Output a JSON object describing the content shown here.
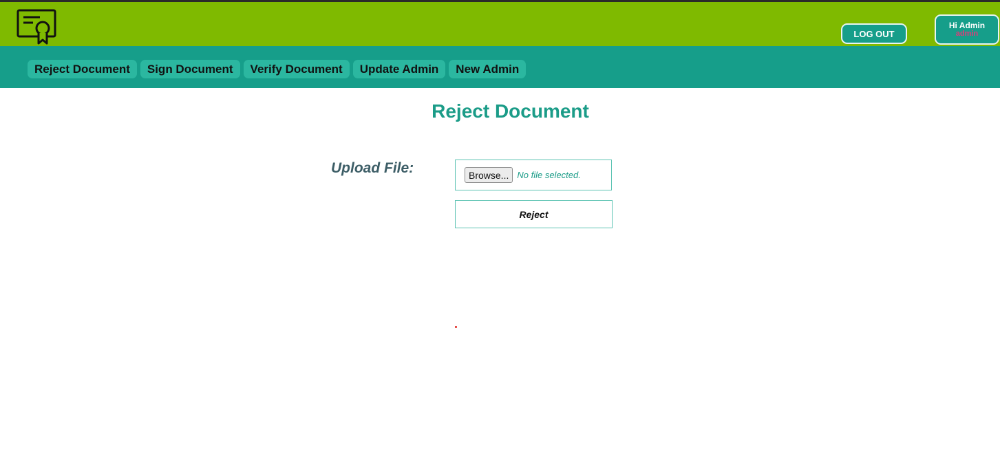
{
  "header": {
    "logo_icon": "certificate-icon",
    "logout_label": "LOG OUT",
    "greeting": "Hi Admin",
    "username": "admin",
    "colors": {
      "topbar": "#7fba00",
      "navbar": "#169e8a",
      "username": "#e23a7a"
    }
  },
  "nav": {
    "items": [
      {
        "label": "Reject Document"
      },
      {
        "label": "Sign Document"
      },
      {
        "label": "Verify Document"
      },
      {
        "label": "Update Admin"
      },
      {
        "label": "New Admin"
      }
    ]
  },
  "main": {
    "title": "Reject Document",
    "upload_label": "Upload File:",
    "browse_label": "Browse...",
    "file_status": "No file selected.",
    "reject_label": "Reject"
  }
}
